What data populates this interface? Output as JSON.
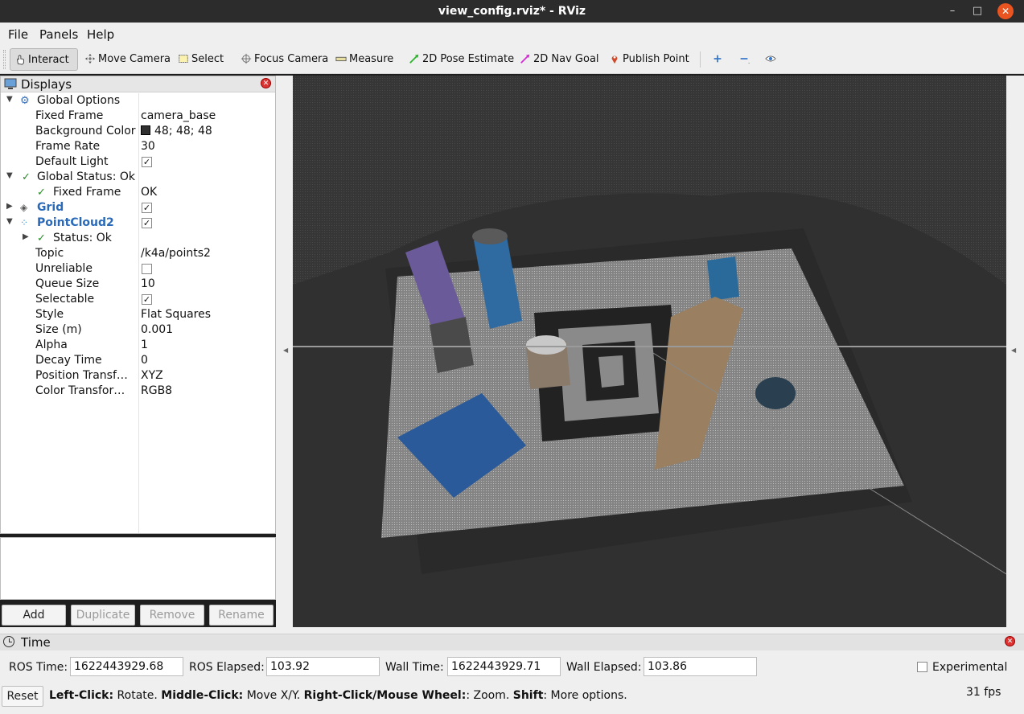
{
  "window": {
    "title": "view_config.rviz* - RViz",
    "min": "–",
    "max": "□",
    "close": "✕"
  },
  "menu": [
    "File",
    "Panels",
    "Help"
  ],
  "toolbar": {
    "interact": "Interact",
    "move_camera": "Move Camera",
    "select": "Select",
    "focus_camera": "Focus Camera",
    "measure": "Measure",
    "pose_estimate": "2D Pose Estimate",
    "nav_goal": "2D Nav Goal",
    "publish_point": "Publish Point"
  },
  "displays": {
    "title": "Displays",
    "global_options": "Global Options",
    "fixed_frame_key": "Fixed Frame",
    "fixed_frame_val": "camera_base",
    "bg_color_key": "Background Color",
    "bg_color_val": "48; 48; 48",
    "frame_rate_key": "Frame Rate",
    "frame_rate_val": "30",
    "default_light_key": "Default Light",
    "global_status": "Global Status: Ok",
    "status_fixed_frame_key": "Fixed Frame",
    "status_fixed_frame_val": "OK",
    "grid": "Grid",
    "pointcloud": "PointCloud2",
    "pc_status": "Status: Ok",
    "topic_key": "Topic",
    "topic_val": "/k4a/points2",
    "unreliable_key": "Unreliable",
    "queue_key": "Queue Size",
    "queue_val": "10",
    "selectable_key": "Selectable",
    "style_key": "Style",
    "style_val": "Flat Squares",
    "size_key": "Size (m)",
    "size_val": "0.001",
    "alpha_key": "Alpha",
    "alpha_val": "1",
    "decay_key": "Decay Time",
    "decay_val": "0",
    "pos_tf_key": "Position Transf…",
    "pos_tf_val": "XYZ",
    "color_tf_key": "Color Transfor…",
    "color_tf_val": "RGB8"
  },
  "buttons": {
    "add": "Add",
    "duplicate": "Duplicate",
    "remove": "Remove",
    "rename": "Rename"
  },
  "time": {
    "title": "Time",
    "ros_time_label": "ROS Time:",
    "ros_time": "1622443929.68",
    "ros_elapsed_label": "ROS Elapsed:",
    "ros_elapsed": "103.92",
    "wall_time_label": "Wall Time:",
    "wall_time": "1622443929.71",
    "wall_elapsed_label": "Wall Elapsed:",
    "wall_elapsed": "103.86",
    "experimental": "Experimental",
    "reset": "Reset",
    "hint_1": "Left-Click:",
    "hint_2": " Rotate. ",
    "hint_3": "Middle-Click:",
    "hint_4": " Move X/Y. ",
    "hint_5": "Right-Click/Mouse Wheel:",
    "hint_6": ": Zoom. ",
    "hint_7": "Shift",
    "hint_8": ": More options.",
    "fps": "31 fps"
  },
  "colors": {
    "background": "#303030",
    "accent": "#2a6ab8",
    "close": "#e95420"
  }
}
